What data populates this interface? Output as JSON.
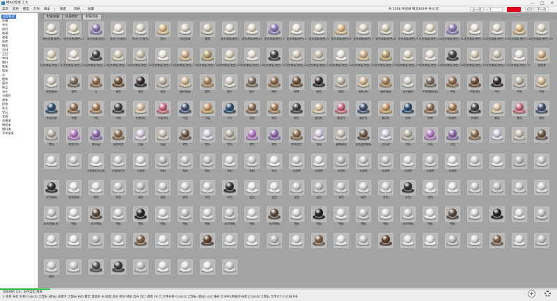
{
  "app": {
    "title": "MAX管家 2.9"
  },
  "window_controls": {
    "minimize": "—",
    "maximize": "□",
    "close": "✕"
  },
  "menu": {
    "items": [
      "菜单",
      "颜色",
      "模型",
      "灯光",
      "脚本",
      "颜色",
      "反射",
      "高光",
      "凹凸",
      "透明",
      "材质",
      "模型",
      "代理",
      "贴图",
      "灯光"
    ],
    "visible": [
      "菜单",
      "颜色",
      "模型",
      "灯光",
      "脚本"
    ],
    "tools": [
      "搜索",
      "风格",
      "收藏"
    ],
    "info": "共 1508 条记录 每页160条 共 8 页",
    "page": "1",
    "nav": [
      "上一页",
      "下一页"
    ],
    "go": "GO",
    "zoom": "缩放"
  },
  "sidebar": {
    "items": [
      "全部材质",
      "金属",
      "布艺",
      "皮料",
      "玻璃",
      "漆面",
      "瓷砖",
      "陶瓷",
      "石材",
      "玉石",
      "木材",
      "塑料",
      "地板",
      "墙纸",
      "水",
      "植物",
      "窗帘",
      "饰品",
      "石头",
      "马赛克",
      "液体",
      "织物",
      "发光",
      "宝石",
      "其他",
      "金属漆",
      "陶瓷漆",
      "塑料漆",
      "写实渲染"
    ],
    "selected": "全部材质"
  },
  "tabs": [
    {
      "label": "材质收藏",
      "active": false
    },
    {
      "label": "快速模式",
      "active": false
    },
    {
      "label": "材质列表",
      "active": true
    }
  ],
  "swatches": [
    [
      "哑光金属(颜色)",
      "哑光金属(颜色) 1",
      "哑光金属(哑光)",
      "哑光 (不透光)",
      "哑光 (不透光)",
      "哑光",
      "拉丝金属",
      "镀铬",
      "优秀漆面(黑色)",
      "优秀漆面(黑色) 2",
      "优秀漆面(黑色) 3",
      "优秀漆面(黑色) 4",
      "优秀漆面(黑色) 5",
      "优秀漆面(黑色) 6",
      "优秀漆面(黑色) 7",
      "优秀漆面(黑色) 8",
      "优秀漆面(黑色) 9",
      "优秀漆面(黑色) 10",
      "优秀漆面(黑色) 11",
      "优秀漆面(黑色) 12",
      "优秀漆面(黑色) 13",
      "优秀漆面(黑色) 14",
      "优秀漆面(黑色) 15"
    ],
    [
      "优秀漆面(黑色) 11",
      "优秀漆面(黑色) 12",
      "优秀漆面(黑色) 13",
      "优秀漆面(黑色) 14",
      "优秀漆面(黑色) 15",
      "优秀漆面(黑色) 16",
      "优秀漆面(黑色) 17",
      "优秀漆面(黑色) 18",
      "优秀漆面(黑色) 19",
      "优秀漆面(黑色) 20",
      "优秀漆面(黑色) 21",
      "优秀漆面(黑色) 22",
      "优秀漆面(黑色) 23",
      "优秀漆面(黑色) 24",
      "优秀漆面(黑色) 25",
      "优秀漆面(黑色) 26",
      "优秀漆面(黑色) 27",
      "优秀漆面(黑色) 28",
      "优秀漆面(黑色) 29",
      "优秀漆面(黑色) 30",
      "优秀漆面(黑色) 31",
      "优秀漆面(黑色) 32",
      "金属漆"
    ],
    [
      "有色玻璃",
      "银色",
      "玉",
      "黄色",
      "黄色",
      "黄色",
      "磨砂玻璃",
      "橙色",
      "橙子",
      "橙子",
      "柳叶",
      "咖啡",
      "黑色",
      "塑料",
      "塑料(黑)",
      "磨砂玻璃",
      "发光磨砂",
      "中黑塑胶(哑)",
      "中黑",
      "中黑(哑)",
      "中红",
      "中黑",
      "中金"
    ],
    [
      "中金色漆",
      "中紫",
      "中红",
      "中黑",
      "中黑(哑)",
      "中蓝(哑)",
      "中蓝",
      "中蓝",
      "竹子",
      "花纹",
      "棕红",
      "棕红",
      "紫红色",
      "紫红色",
      "紫红色",
      "紫红色",
      "棕黄",
      "棕黄",
      "棕黄色",
      "棕黄色",
      "紫色",
      "紫色",
      "紫色"
    ],
    [
      "紫色",
      "紫色大头",
      "紫水晶",
      "自然灰色",
      "白瓷",
      "白瓷",
      "棕色",
      "棕色",
      "棕色",
      "棕色",
      "棕色",
      "棕色灰大",
      "花纹",
      "模糊玻璃",
      "白色透明塑料",
      "白色漆",
      "白色",
      "白色",
      "白色",
      "",
      "",
      "",
      ""
    ],
    [
      "",
      "",
      "不透明红色(黑)",
      "不透明红色",
      "不透明",
      "布料",
      "布料",
      "布料",
      "布料",
      "布料",
      "哑光",
      "半透明",
      "半透明",
      "半透明",
      "半透明",
      "半透明",
      "半透明",
      "半透明",
      "半透明",
      "",
      "",
      "",
      ""
    ],
    [
      "红色玻璃",
      "花纹玻璃",
      "粉色",
      "花纹",
      "黄金",
      "黄金",
      "黄色",
      "灰色",
      "灰色",
      "蓝色",
      "蓝色",
      "蓝色",
      "蓝色",
      "黄色",
      "绿色",
      "红色",
      "红色",
      "红色",
      "",
      "",
      "",
      "",
      ""
    ],
    [
      "高光地板(灰)",
      "地板",
      "高光地板",
      "地板",
      "地板",
      "地板",
      "地板",
      "地板",
      "高光地板",
      "地板",
      "高光地板",
      "地板",
      "地板",
      "地板",
      "地板",
      "地板",
      "高光地板",
      "地板",
      "地板",
      "",
      "",
      "",
      ""
    ],
    [
      "",
      "",
      "",
      "",
      "",
      "",
      "",
      "",
      "",
      "",
      "",
      "",
      "",
      "",
      "",
      "",
      "",
      "",
      "",
      "",
      "",
      "",
      ""
    ],
    [
      "黑色",
      "",
      "",
      "",
      "",
      "",
      "",
      "",
      "",
      "",
      "",
      "",
      "",
      "",
      "",
      "",
      "",
      "",
      "",
      "",
      "",
      "",
      ""
    ],
    [
      "",
      "",
      "",
      "",
      "",
      "",
      "",
      "",
      "",
      "",
      "",
      "",
      "",
      "",
      "",
      "",
      "",
      "",
      "",
      "",
      "",
      "",
      ""
    ]
  ],
  "status": {
    "line1": "渲染相机 1/6 | 文件类型 材质",
    "line2": "1 条目 布料 名称 Colesta 大理石 (抛光) 关键字 大理石 布料 模型 漫反射 布 贴图 反射 折射 材质 高光 凹凸 透明 20 万 文件名称 Colesta 大理石 (抛光).mat 路径 D:\\MAX材质库\\布料\\Colesta 大理石 文件大小 0.018 MB",
    "progress": 0.09
  },
  "icons": {
    "plus": "plus-icon",
    "gear": "gear-icon"
  }
}
